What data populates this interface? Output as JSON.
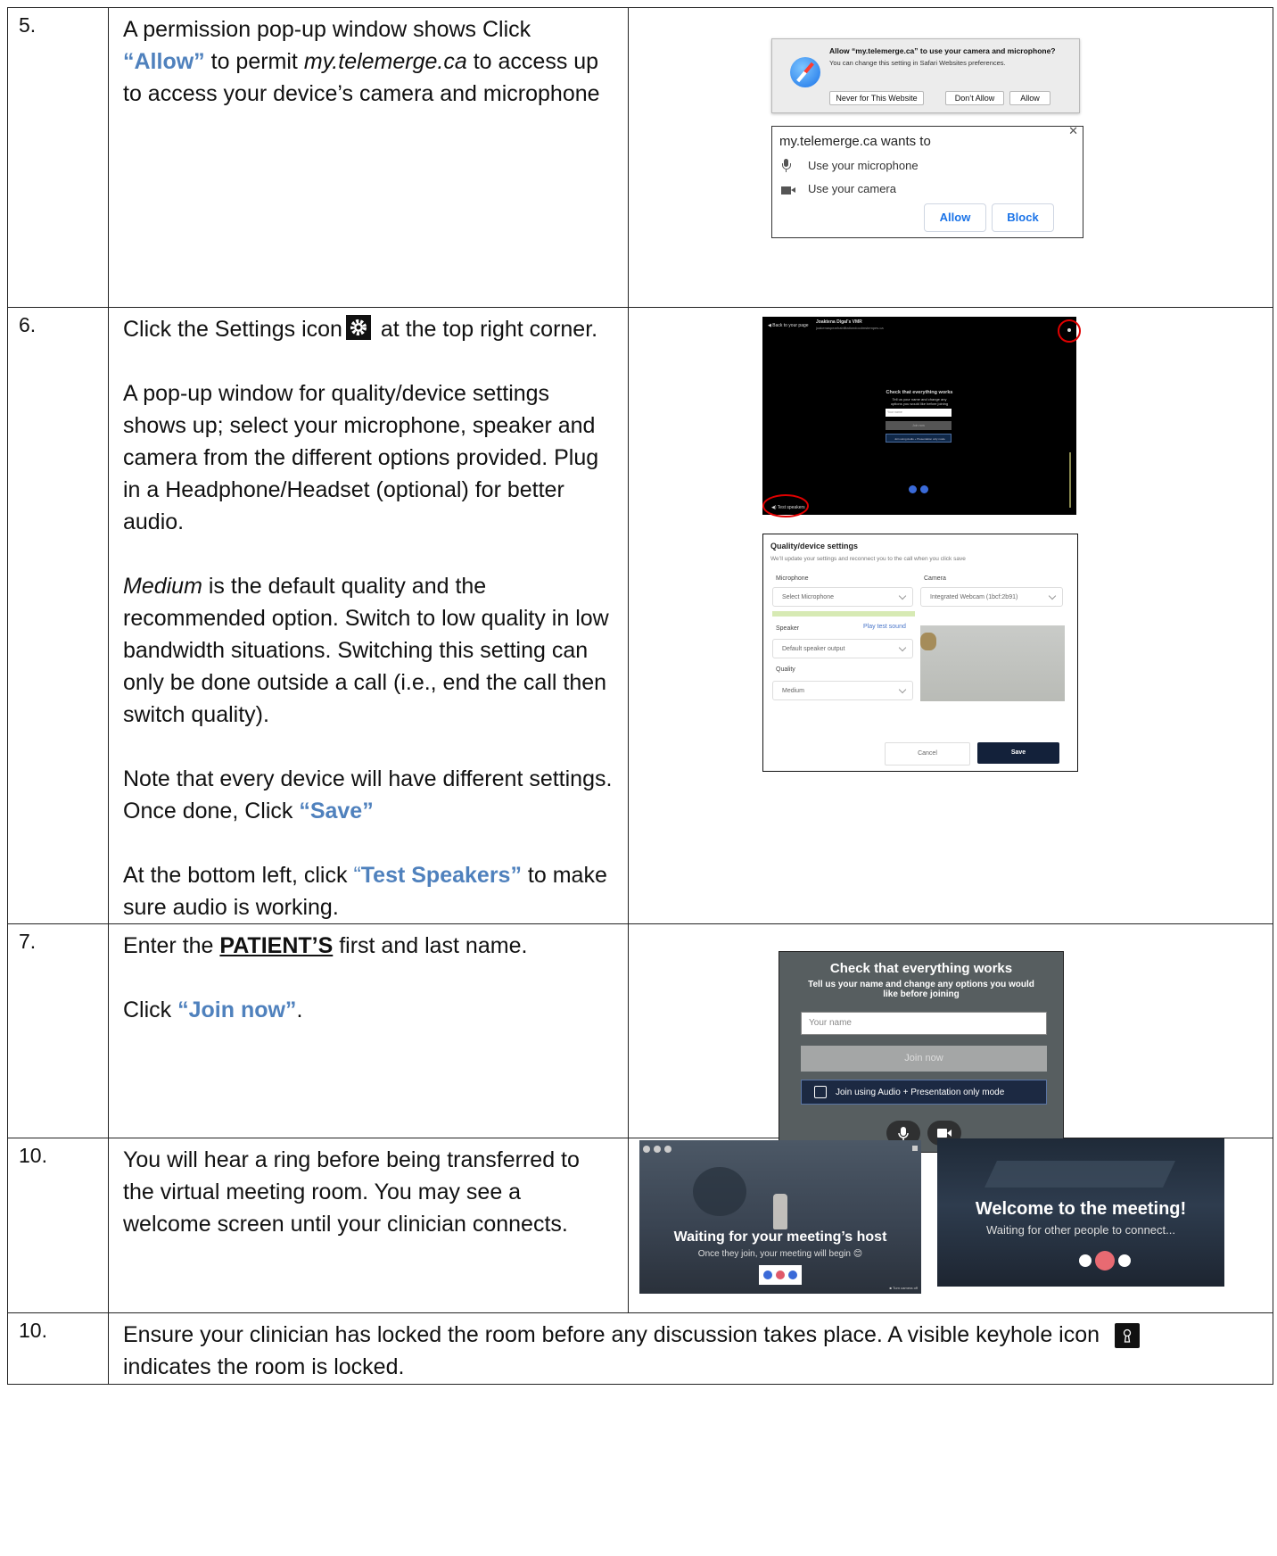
{
  "rows": [
    {
      "num": "5.",
      "text": {
        "p1_a": "A permission pop-up window shows Click ",
        "p1_allow": "“Allow”",
        "p1_b": " to permit ",
        "p1_site": "my.telemerge.ca",
        "p1_c": " to access up to access your device’s camera and microphone"
      },
      "safari_prompt": {
        "title": "Allow “my.telemerge.ca” to use your camera and microphone?",
        "subtitle": "You can change this setting in Safari Websites preferences.",
        "buttons": [
          "Never for This Website",
          "Don’t Allow",
          "Allow"
        ]
      },
      "chrome_prompt": {
        "title": "my.telemerge.ca wants to",
        "items": [
          "Use your microphone",
          "Use your camera"
        ],
        "allow": "Allow",
        "block": "Block",
        "close": "✕"
      }
    },
    {
      "num": "6.",
      "text": {
        "p1_a": "Click the Settings icon",
        "p1_b": " at the top right corner.",
        "p2": "A pop-up window for quality/device settings shows up; select your microphone, speaker and camera from the different options provided. Plug in a Headphone/Headset (optional) for better audio.",
        "p3_em": "Medium",
        "p3_rest": " is the default quality and the recommended option. Switch to low quality in low bandwidth situations.  Switching this setting can only be done outside a call (i.e., end the call then switch quality).",
        "p4_a": "Note that every device will have different settings.  Once done, Click ",
        "p4_save": "“Save”",
        "p5_a": "At the bottom left, click ",
        "p5_q": "“",
        "p5_test": "Test Speakers”",
        "p5_b": " to make sure audio is working."
      },
      "dark_screen": {
        "back": "◀ Back to your page",
        "name": "Joaktena Digal's VMR",
        "email": "joakenaspearhabilitationdocdmstempes.ca",
        "check_title": "Check that everything works",
        "check_sub": "Tell us your name and change any options you would like before joining",
        "your_name": "Your name",
        "join": "Join now",
        "audio_mode": "Join using Audio + Presentation only mode",
        "test_speakers": "◀) Test speakers"
      },
      "settings": {
        "title": "Quality/device settings",
        "subtitle": "We’ll update your settings and reconnect you to the call when you click save",
        "microphone_label": "Microphone",
        "microphone_value": "Select Microphone",
        "camera_label": "Camera",
        "camera_value": "Integrated Webcam (1bcf:2b91)",
        "speaker_label": "Speaker",
        "play_test": "Play test sound",
        "speaker_value": "Default speaker output",
        "quality_label": "Quality",
        "quality_value": "Medium",
        "cancel": "Cancel",
        "save": "Save"
      }
    },
    {
      "num": "7.",
      "text": {
        "p1_a": "Enter the ",
        "p1_patient": "PATIENT’S",
        "p1_b": " first and last name.",
        "p2_a": "Click ",
        "p2_join": "“Join now”",
        "p2_b": "."
      },
      "check": {
        "title": "Check that everything works",
        "subtitle": "Tell us your name and change any options you would like before joining",
        "placeholder": "Your name",
        "join": "Join now",
        "audio_mode": "Join using Audio + Presentation only mode"
      }
    },
    {
      "num": "10.",
      "text": "You will hear a ring before being transferred to the virtual meeting room.  You may see a welcome screen until your clinician connects.",
      "waiting": {
        "title": "Waiting for your meeting’s host",
        "subtitle": "Once they join, your meeting will begin 😊",
        "corner": "■ Turn camera off"
      },
      "welcome": {
        "title": "Welcome to the meeting!",
        "subtitle": "Waiting for other people to connect..."
      }
    },
    {
      "num": "10.",
      "text_a": "Ensure your clinician has locked the room before any discussion takes place.  A visible keyhole icon ",
      "text_b": "indicates the room is locked."
    }
  ]
}
